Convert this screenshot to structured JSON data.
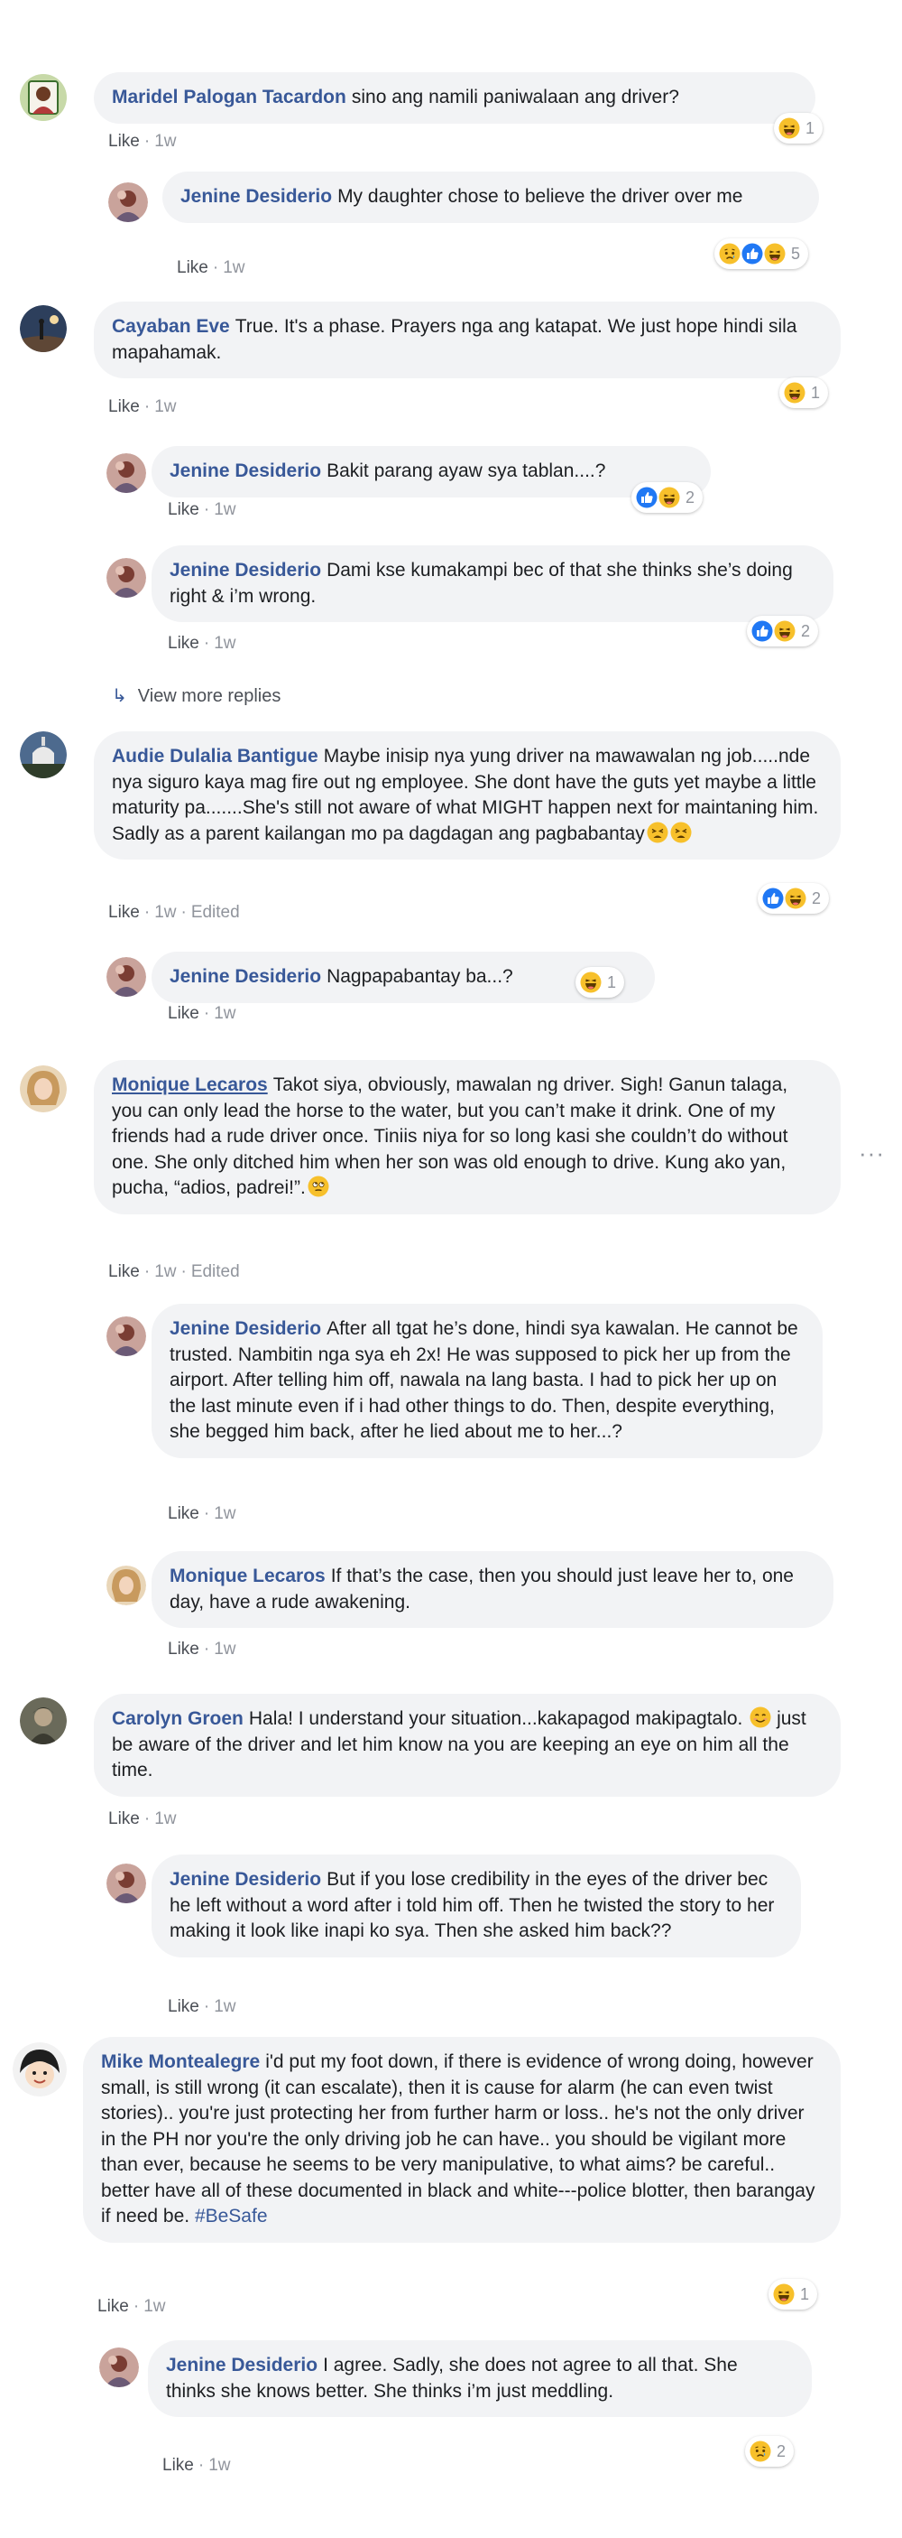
{
  "meta_labels": {
    "like": "Like",
    "time": "1w",
    "edited": "Edited"
  },
  "view_more_replies": "View more replies",
  "comments": [
    {
      "name": "Maridel Palogan Tacardon",
      "text": "sino ang namili paniwalaan ang driver?",
      "reaction_count": "1"
    },
    {
      "name": "Jenine Desiderio",
      "text": "My daughter chose to believe the driver over me",
      "reaction_count": "5"
    },
    {
      "name": "Cayaban Eve",
      "text": "True. It's a phase. Prayers nga ang katapat. We just hope hindi sila mapahamak.",
      "reaction_count": "1"
    },
    {
      "name": "Jenine Desiderio",
      "text": "Bakit parang ayaw sya tablan....?",
      "reaction_count": "2"
    },
    {
      "name": "Jenine Desiderio",
      "text": "Dami kse kumakampi bec of that she thinks she’s doing right & i’m wrong.",
      "reaction_count": "2"
    },
    {
      "name": "Audie Dulalia Bantigue",
      "text": "Maybe inisip nya yung driver na mawawalan ng job.....nde nya siguro kaya mag fire out ng employee. She dont have the guts yet maybe a little maturity pa.......She's still not aware of what MIGHT happen next for maintaning him. Sadly as a parent kailangan mo pa dagdagan ang pagbabantay",
      "reaction_count": "2"
    },
    {
      "name": "Jenine Desiderio",
      "text": "Nagpapabantay ba...?",
      "reaction_count": "1"
    },
    {
      "name": "Monique Lecaros",
      "text": "Takot siya, obviously, mawalan ng driver. Sigh! Ganun talaga, you can only lead the horse to the water, but you can’t make it drink. One of my friends had a rude driver once. Tiniis niya for so long kasi she couldn’t do without one. She only ditched him when her son was old enough to drive. Kung ako yan, pucha, “adios, padrei!”."
    },
    {
      "name": "Jenine Desiderio",
      "text": "After all tgat he’s done, hindi sya kawalan. He cannot be trusted. Nambitin nga sya eh 2x! He was supposed to pick her up from the airport. After telling him off, nawala na lang basta. I had to pick her up on the last minute even if i had other things to do. Then, despite everything, she begged him back, after he lied about me to her...?"
    },
    {
      "name": "Monique Lecaros",
      "text": "If that’s the case, then you should just leave her to, one day, have a rude awakening."
    },
    {
      "name": "Carolyn Groen",
      "text": "Hala! I understand your situation...kakapagod makipagtalo.",
      "text2": "just be aware of the driver and let him know na you are keeping an eye on him all the time."
    },
    {
      "name": "Jenine Desiderio",
      "text": "But if you lose credibility in the eyes of the driver bec he left without a word after i told him off. Then he twisted the story to her making it look like inapi ko sya. Then she asked him back??"
    },
    {
      "name": "Mike Montealegre",
      "text": "i'd put my foot down, if there is evidence of wrong doing, however small, is still wrong (it can escalate), then it is cause for alarm (he can even twist stories).. you're just protecting her from further harm or loss.. he's not the only driver in the PH nor you're the only driving job he can have.. you should be vigilant more than ever, because he seems to be very manipulative, to what aims? be careful.. better have all of these documented in black and white---police blotter, then barangay if need be.",
      "hashtag": "#BeSafe",
      "reaction_count": "1"
    },
    {
      "name": "Jenine Desiderio",
      "text": "I agree. Sadly, she does not agree to all that. She thinks she knows better. She thinks i’m just meddling.",
      "reaction_count": "2"
    }
  ],
  "colors": {
    "name_link": "#385898",
    "bubble_bg": "#f2f3f5",
    "meta_gray": "#90949c",
    "like_blue": "#2078f4",
    "haha_yellow": "#f7c02b"
  }
}
